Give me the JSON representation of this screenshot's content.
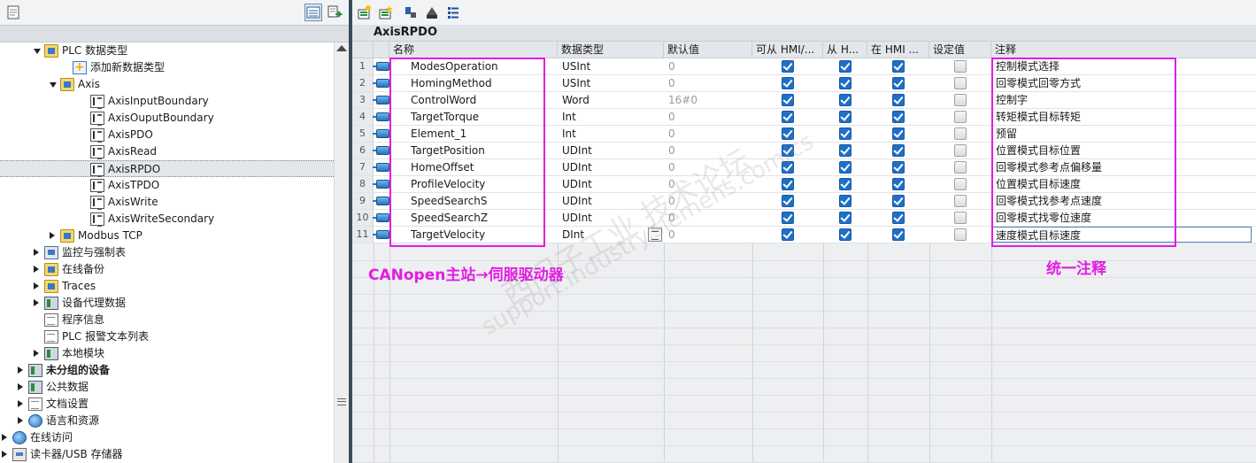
{
  "left_toolbar": {
    "icons": [
      "table-view-icon",
      "import-export-icon"
    ]
  },
  "tree": {
    "items": [
      {
        "label": "PLC 数据类型",
        "icon": "folder-icon",
        "state": "expanded"
      },
      {
        "label": "添加新数据类型",
        "icon": "add-type-icon",
        "state": "leaf"
      },
      {
        "label": "Axis",
        "icon": "folder-icon",
        "state": "expanded"
      },
      {
        "label": "AxisInputBoundary",
        "icon": "udt-icon",
        "state": "leaf"
      },
      {
        "label": "AxisOuputBoundary",
        "icon": "udt-icon",
        "state": "leaf"
      },
      {
        "label": "AxisPDO",
        "icon": "udt-icon",
        "state": "leaf"
      },
      {
        "label": "AxisRead",
        "icon": "udt-icon",
        "state": "leaf"
      },
      {
        "label": "AxisRPDO",
        "icon": "udt-icon",
        "state": "leaf",
        "selected": true
      },
      {
        "label": "AxisTPDO",
        "icon": "udt-icon",
        "state": "leaf"
      },
      {
        "label": "AxisWrite",
        "icon": "udt-icon",
        "state": "leaf"
      },
      {
        "label": "AxisWriteSecondary",
        "icon": "udt-icon",
        "state": "leaf"
      },
      {
        "label": "Modbus TCP",
        "icon": "folder-icon",
        "state": "collapsed"
      },
      {
        "label": "监控与强制表",
        "icon": "monitor-table-icon",
        "state": "collapsed"
      },
      {
        "label": "在线备份",
        "icon": "folder-icon",
        "state": "collapsed"
      },
      {
        "label": "Traces",
        "icon": "folder-icon",
        "state": "collapsed"
      },
      {
        "label": "设备代理数据",
        "icon": "device-proxy-icon",
        "state": "collapsed"
      },
      {
        "label": "程序信息",
        "icon": "program-info-icon",
        "state": "leaf"
      },
      {
        "label": "PLC 报警文本列表",
        "icon": "alarm-text-icon",
        "state": "leaf"
      },
      {
        "label": "本地模块",
        "icon": "local-modules-icon",
        "state": "collapsed"
      },
      {
        "label": "未分组的设备",
        "icon": "ungrouped-devices-icon",
        "state": "collapsed",
        "bold": true
      },
      {
        "label": "公共数据",
        "icon": "common-data-icon",
        "state": "collapsed"
      },
      {
        "label": "文档设置",
        "icon": "document-settings-icon",
        "state": "collapsed"
      },
      {
        "label": "语言和资源",
        "icon": "languages-icon",
        "state": "collapsed"
      },
      {
        "label": "在线访问",
        "icon": "online-access-icon",
        "state": "collapsed"
      },
      {
        "label": "读卡器/USB 存储器",
        "icon": "card-reader-icon",
        "state": "collapsed"
      }
    ]
  },
  "right_toolbar": {
    "icons": [
      "insert-row-icon",
      "add-row-icon",
      "expand-icon",
      "monitor-icon",
      "details-icon"
    ]
  },
  "block": {
    "title": "AxisRPDO"
  },
  "grid": {
    "headers": {
      "name": "名称",
      "type": "数据类型",
      "default": "默认值",
      "hmi_access": "可从 HMI/...",
      "hmi_visible": "从 H...",
      "hmi_setpoint": "在 HMI ...",
      "setpoint": "设定值",
      "comment": "注释"
    },
    "rows": [
      {
        "num": "1",
        "name": "ModesOperation",
        "type": "USInt",
        "default": "0",
        "hmi_access": true,
        "hmi_visible": true,
        "hmi_setpoint": true,
        "setpoint": false,
        "comment": "控制模式选择"
      },
      {
        "num": "2",
        "name": "HomingMethod",
        "type": "USInt",
        "default": "0",
        "hmi_access": true,
        "hmi_visible": true,
        "hmi_setpoint": true,
        "setpoint": false,
        "comment": "回零模式回零方式"
      },
      {
        "num": "3",
        "name": "ControlWord",
        "type": "Word",
        "default": "16#0",
        "hmi_access": true,
        "hmi_visible": true,
        "hmi_setpoint": true,
        "setpoint": false,
        "comment": "控制字"
      },
      {
        "num": "4",
        "name": "TargetTorque",
        "type": "Int",
        "default": "0",
        "hmi_access": true,
        "hmi_visible": true,
        "hmi_setpoint": true,
        "setpoint": false,
        "comment": "转矩模式目标转矩"
      },
      {
        "num": "5",
        "name": "Element_1",
        "type": "Int",
        "default": "0",
        "hmi_access": true,
        "hmi_visible": true,
        "hmi_setpoint": true,
        "setpoint": false,
        "comment": "预留"
      },
      {
        "num": "6",
        "name": "TargetPosition",
        "type": "UDInt",
        "default": "0",
        "hmi_access": true,
        "hmi_visible": true,
        "hmi_setpoint": true,
        "setpoint": false,
        "comment": "位置模式目标位置"
      },
      {
        "num": "7",
        "name": "HomeOffset",
        "type": "UDInt",
        "default": "0",
        "hmi_access": true,
        "hmi_visible": true,
        "hmi_setpoint": true,
        "setpoint": false,
        "comment": "回零模式参考点偏移量"
      },
      {
        "num": "8",
        "name": "ProfileVelocity",
        "type": "UDInt",
        "default": "0",
        "hmi_access": true,
        "hmi_visible": true,
        "hmi_setpoint": true,
        "setpoint": false,
        "comment": "位置模式目标速度"
      },
      {
        "num": "9",
        "name": "SpeedSearchS",
        "type": "UDInt",
        "default": "0",
        "hmi_access": true,
        "hmi_visible": true,
        "hmi_setpoint": true,
        "setpoint": false,
        "comment": "回零模式找参考点速度"
      },
      {
        "num": "10",
        "name": "SpeedSearchZ",
        "type": "UDInt",
        "default": "0",
        "hmi_access": true,
        "hmi_visible": true,
        "hmi_setpoint": true,
        "setpoint": false,
        "comment": "回零模式找零位速度"
      },
      {
        "num": "11",
        "name": "TargetVelocity",
        "type": "DInt",
        "default": "0",
        "hmi_access": true,
        "hmi_visible": true,
        "hmi_setpoint": true,
        "setpoint": false,
        "comment": "速度模式目标速度"
      }
    ]
  },
  "annotations": {
    "left_label": "CANopen主站→伺服驱动器",
    "right_label": "统一注释",
    "color": "#e31ce3"
  },
  "watermark": {
    "line1": "西门子工业 技术论坛",
    "line2": "support.industry.siemens.com/cs"
  },
  "colors": {
    "checkbox_on": "#1e6fc8",
    "splitter": "#3b4b5c"
  }
}
